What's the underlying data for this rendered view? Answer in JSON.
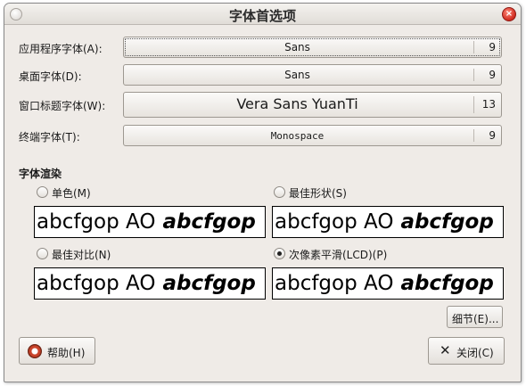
{
  "window": {
    "title": "字体首选项",
    "close_glyph": "×"
  },
  "fonts": [
    {
      "label": "应用程序字体(A):",
      "name": "Sans",
      "size": "9"
    },
    {
      "label": "桌面字体(D):",
      "name": "Sans",
      "size": "9"
    },
    {
      "label": "窗口标题字体(W):",
      "name": "Vera Sans YuanTi",
      "size": "13"
    },
    {
      "label": "终端字体(T):",
      "name": "Monospace",
      "size": "9"
    }
  ],
  "rendering": {
    "title": "字体渲染",
    "options": [
      {
        "label": "单色(M)",
        "selected": false
      },
      {
        "label": "最佳形状(S)",
        "selected": false
      },
      {
        "label": "最佳对比(N)",
        "selected": false
      },
      {
        "label": "次像素平滑(LCD)(P)",
        "selected": true
      }
    ],
    "sample_plain": "abcfgop AO",
    "sample_italic": "abcfgop"
  },
  "buttons": {
    "details": "细节(E)...",
    "help": "帮助(H)",
    "close": "关闭(C)"
  },
  "icons": {
    "window_menu": "window-menu-icon",
    "window_close": "window-close-icon",
    "help": "help-lifebuoy-icon",
    "close": "close-x-icon"
  }
}
